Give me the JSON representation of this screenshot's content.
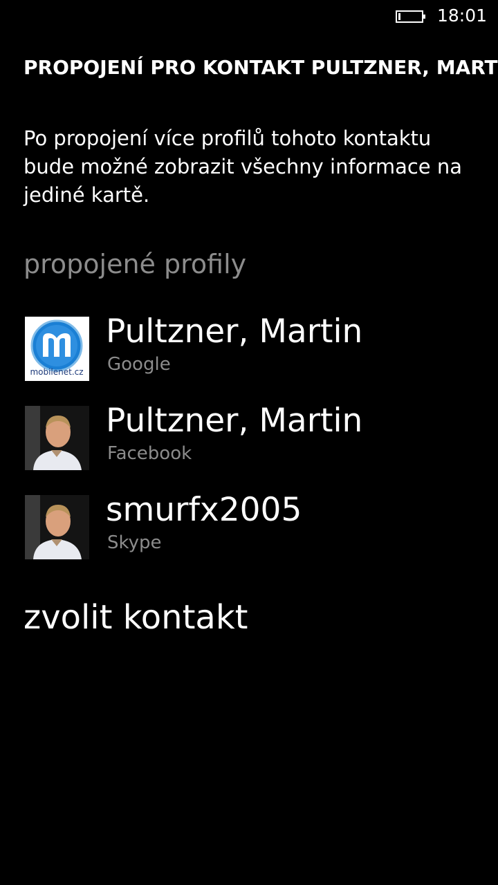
{
  "status_bar": {
    "battery_icon": "battery-icon",
    "time": "18:01"
  },
  "header": {
    "title": "PROPOJENÍ PRO KONTAKT PULTZNER, MARTIN"
  },
  "description": "Po propojení více profilů tohoto kontaktu bude možné zobrazit všechny informace na jediné kartě.",
  "section": {
    "label": "propojené profily"
  },
  "profiles": [
    {
      "name": "Pultzner, Martin",
      "service": "Google",
      "avatar": "mobilenet-logo",
      "avatar_text": "mobilenet.cz"
    },
    {
      "name": "Pultzner, Martin",
      "service": "Facebook",
      "avatar": "person-photo"
    },
    {
      "name": "smurfx2005",
      "service": "Skype",
      "avatar": "person-photo"
    }
  ],
  "actions": {
    "choose_contact": "zvolit kontakt"
  },
  "colors": {
    "background": "#000000",
    "text": "#ffffff",
    "secondary_text": "#8c8c8c",
    "logo_blue": "#1a7fd4"
  }
}
